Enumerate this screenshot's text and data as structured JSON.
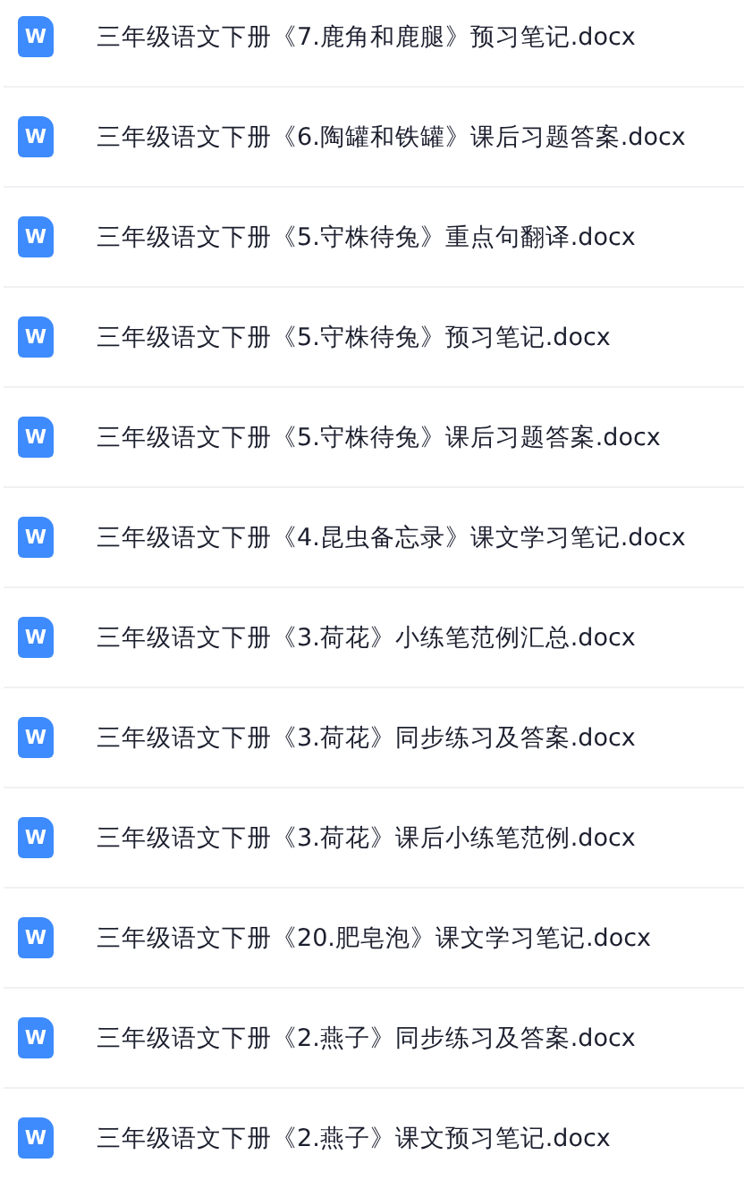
{
  "files": [
    {
      "name": "三年级语文下册《7.鹿角和鹿腿》预习笔记.docx",
      "icon_letter": "W"
    },
    {
      "name": "三年级语文下册《6.陶罐和铁罐》课后习题答案.docx",
      "icon_letter": "W"
    },
    {
      "name": "三年级语文下册《5.守株待兔》重点句翻译.docx",
      "icon_letter": "W"
    },
    {
      "name": "三年级语文下册《5.守株待兔》预习笔记.docx",
      "icon_letter": "W"
    },
    {
      "name": "三年级语文下册《5.守株待兔》课后习题答案.docx",
      "icon_letter": "W"
    },
    {
      "name": "三年级语文下册《4.昆虫备忘录》课文学习笔记.docx",
      "icon_letter": "W"
    },
    {
      "name": "三年级语文下册《3.荷花》小练笔范例汇总.docx",
      "icon_letter": "W"
    },
    {
      "name": "三年级语文下册《3.荷花》同步练习及答案.docx",
      "icon_letter": "W"
    },
    {
      "name": "三年级语文下册《3.荷花》课后小练笔范例.docx",
      "icon_letter": "W"
    },
    {
      "name": "三年级语文下册《20.肥皂泡》课文学习笔记.docx",
      "icon_letter": "W"
    },
    {
      "name": "三年级语文下册《2.燕子》同步练习及答案.docx",
      "icon_letter": "W"
    },
    {
      "name": "三年级语文下册《2.燕子》课文预习笔记.docx",
      "icon_letter": "W"
    }
  ]
}
